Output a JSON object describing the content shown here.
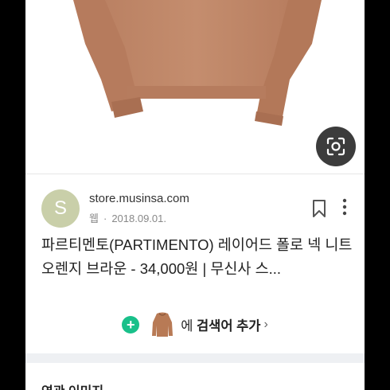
{
  "source": {
    "avatar_letter": "S",
    "domain": "store.musinsa.com",
    "type_label": "웹",
    "date": "2018.09.01."
  },
  "result_title": "파르티멘토(PARTIMENTO) 레이어드 폴로 넥 니트 오렌지 브라운 - 34,000원 | 무신사 스...",
  "add_search": {
    "prefix": "에",
    "action": "검색어 추가",
    "chevron": "›"
  },
  "related_section": {
    "heading": "연관 이미지"
  },
  "icons": [
    "lens-icon",
    "bookmark-icon",
    "more-vert-icon",
    "plus-icon",
    "sweater-thumbnail"
  ],
  "colors": {
    "accent_green": "#19c08a",
    "sweater": "#c0896a",
    "avatar_bg": "#c9cfa9"
  }
}
